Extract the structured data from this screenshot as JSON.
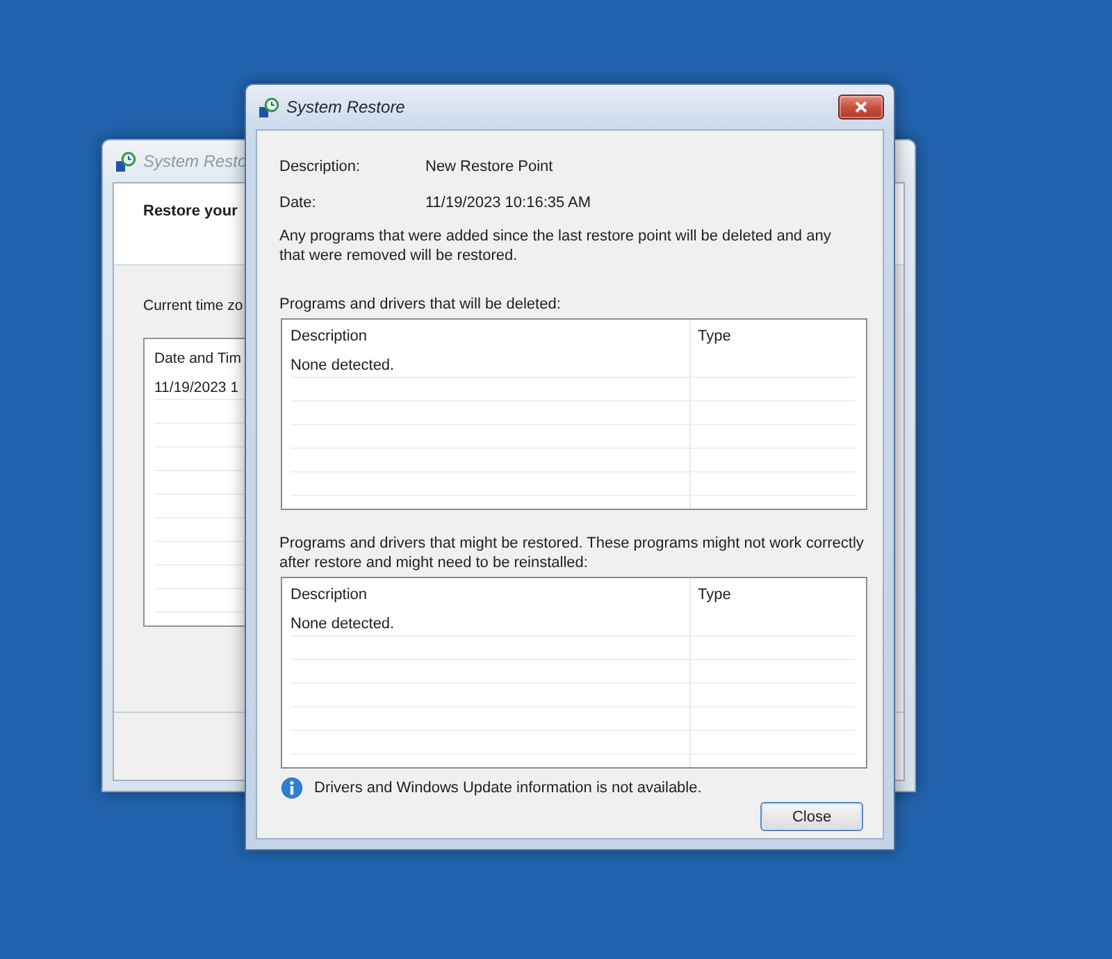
{
  "windows": [
    {
      "kind": "wizard",
      "active": false,
      "title": "System Resto",
      "heading": "Restore your",
      "label": "Current time zo",
      "list": {
        "columns": [
          "Date and Tim"
        ],
        "rows": [
          [
            "11/19/2023 1"
          ]
        ]
      }
    },
    {
      "kind": "details",
      "active": true,
      "title": "System Restore",
      "fields": [
        {
          "label": "Description:",
          "value": "New Restore Point"
        },
        {
          "label": "Date:",
          "value": "11/19/2023 10:16:35 AM"
        }
      ],
      "note": "Any programs that were added since the last restore point will be deleted and any that were removed will be restored.",
      "sections": [
        {
          "label": "Programs and drivers that will be deleted:",
          "columns": [
            "Description",
            "Type"
          ],
          "rows": [
            [
              "None detected."
            ]
          ]
        },
        {
          "label": "Programs and drivers that might be restored. These programs might not work correctly after restore and might need to be reinstalled:",
          "columns": [
            "Description",
            "Type"
          ],
          "rows": [
            [
              "None detected."
            ]
          ]
        }
      ],
      "info": "Drivers and Windows Update information is not available.",
      "buttons": [
        "Close"
      ]
    }
  ]
}
